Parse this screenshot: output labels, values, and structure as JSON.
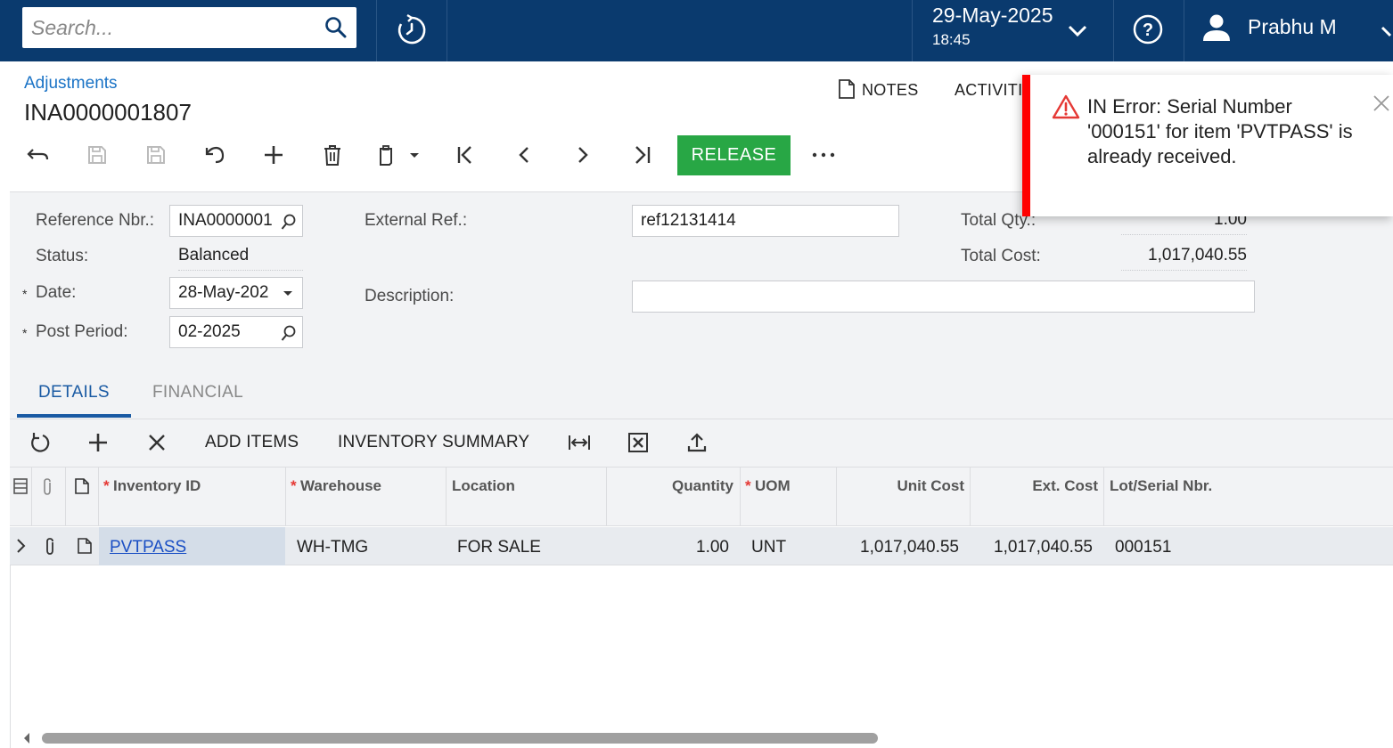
{
  "topbar": {
    "search_placeholder": "Search...",
    "date": "29-May-2025",
    "time": "18:45",
    "user_name": "Prabhu M"
  },
  "header": {
    "breadcrumb": "Adjustments",
    "title": "INA0000001807",
    "notes_label": "NOTES",
    "activities_label": "ACTIVITI"
  },
  "toolbar": {
    "release_label": "RELEASE"
  },
  "form": {
    "reference_label": "Reference Nbr.:",
    "reference_value": "INA0000001",
    "status_label": "Status:",
    "status_value": "Balanced",
    "date_label": "Date:",
    "date_value": "28-May-202",
    "post_period_label": "Post Period:",
    "post_period_value": "02-2025",
    "external_ref_label": "External Ref.:",
    "external_ref_value": "ref12131414",
    "description_label": "Description:",
    "description_value": "",
    "total_qty_label": "Total Qty.:",
    "total_qty_value": "1.00",
    "total_cost_label": "Total Cost:",
    "total_cost_value": "1,017,040.55",
    "required_mark": "*"
  },
  "tabs": [
    {
      "label": "DETAILS",
      "active": true
    },
    {
      "label": "FINANCIAL",
      "active": false
    }
  ],
  "grid_toolbar": {
    "add_items": "ADD ITEMS",
    "inventory_summary": "INVENTORY SUMMARY"
  },
  "grid": {
    "columns": {
      "inventory_id": "Inventory ID",
      "warehouse": "Warehouse",
      "location": "Location",
      "quantity": "Quantity",
      "uom": "UOM",
      "unit_cost": "Unit Cost",
      "ext_cost": "Ext. Cost",
      "lot_serial": "Lot/Serial Nbr."
    },
    "rows": [
      {
        "inventory_id": "PVTPASS",
        "warehouse": "WH-TMG",
        "location": "FOR SALE",
        "quantity": "1.00",
        "uom": "UNT",
        "unit_cost": "1,017,040.55",
        "ext_cost": "1,017,040.55",
        "lot_serial": "000151"
      }
    ]
  },
  "notification": {
    "message": "IN Error: Serial Number '000151' for item 'PVTPASS' is already received."
  },
  "colors": {
    "topbar": "#0a3a6e",
    "release": "#28a745",
    "error": "#ff0000",
    "link": "#1a73c6"
  }
}
